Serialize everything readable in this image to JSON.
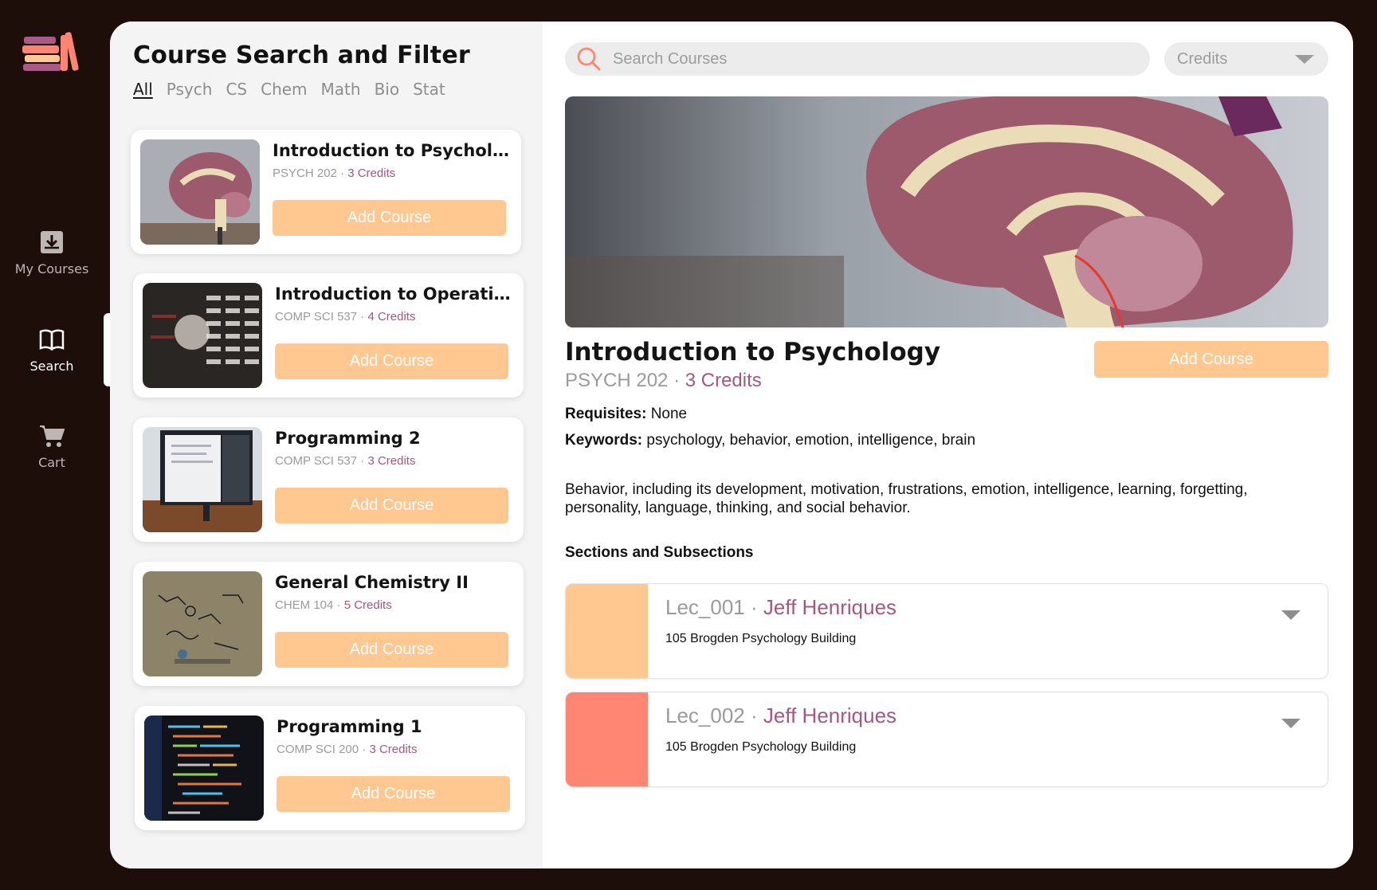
{
  "nav": {
    "items": [
      {
        "label": "My Courses",
        "icon": "download-tray-icon",
        "active": false
      },
      {
        "label": "Search",
        "icon": "open-book-icon",
        "active": true
      },
      {
        "label": "Cart",
        "icon": "cart-icon",
        "active": false
      }
    ]
  },
  "list": {
    "title": "Course Search and Filter",
    "filters": [
      "All",
      "Psych",
      "CS",
      "Chem",
      "Math",
      "Bio",
      "Stat"
    ],
    "active_filter": "All",
    "courses": [
      {
        "title": "Introduction to Psychology",
        "code": "PSYCH 202",
        "credits": "3 Credits",
        "button": "Add Course",
        "image": "brain-model-photo"
      },
      {
        "title": "Introduction to Operating S...",
        "code": "COMP SCI 537",
        "credits": "4 Credits",
        "button": "Add Course",
        "image": "server-lights-photo"
      },
      {
        "title": "Programming 2",
        "code": "COMP SCI 537",
        "credits": "3 Credits",
        "button": "Add Course",
        "image": "monitor-desk-photo"
      },
      {
        "title": "General Chemistry II",
        "code": "CHEM 104",
        "credits": "5 Credits",
        "button": "Add Course",
        "image": "chemistry-glass-photo"
      },
      {
        "title": "Programming 1",
        "code": "COMP SCI 200",
        "credits": "3 Credits",
        "button": "Add Course",
        "image": "code-screen-photo"
      }
    ]
  },
  "search": {
    "placeholder": "Search Courses"
  },
  "credits_filter": {
    "label": "Credits"
  },
  "detail": {
    "title": "Introduction to Psychology",
    "code": "PSYCH 202",
    "credits": "3 Credits",
    "button": "Add Course",
    "requisites_label": "Requisites:",
    "requisites": "None",
    "keywords_label": "Keywords:",
    "keywords": "psychology, behavior, emotion, intelligence, brain",
    "description": "Behavior, including its development, motivation, frustrations, emotion, intelligence, learning, forgetting, personality, language, thinking, and social behavior.",
    "sections_heading": "Sections and Subsections",
    "sections": [
      {
        "name": "Lec_001",
        "instructor": "Jeff Henriques",
        "location": "105 Brogden Psychology Building",
        "color": "#ffc890"
      },
      {
        "name": "Lec_002",
        "instructor": "Jeff Henriques",
        "location": "105 Brogden Psychology Building",
        "color": "#ff8672"
      }
    ]
  },
  "colors": {
    "background": "#1d0e09",
    "accent_button": "#ffc890",
    "credits_text": "#a2587f",
    "section_2": "#ff8672"
  }
}
